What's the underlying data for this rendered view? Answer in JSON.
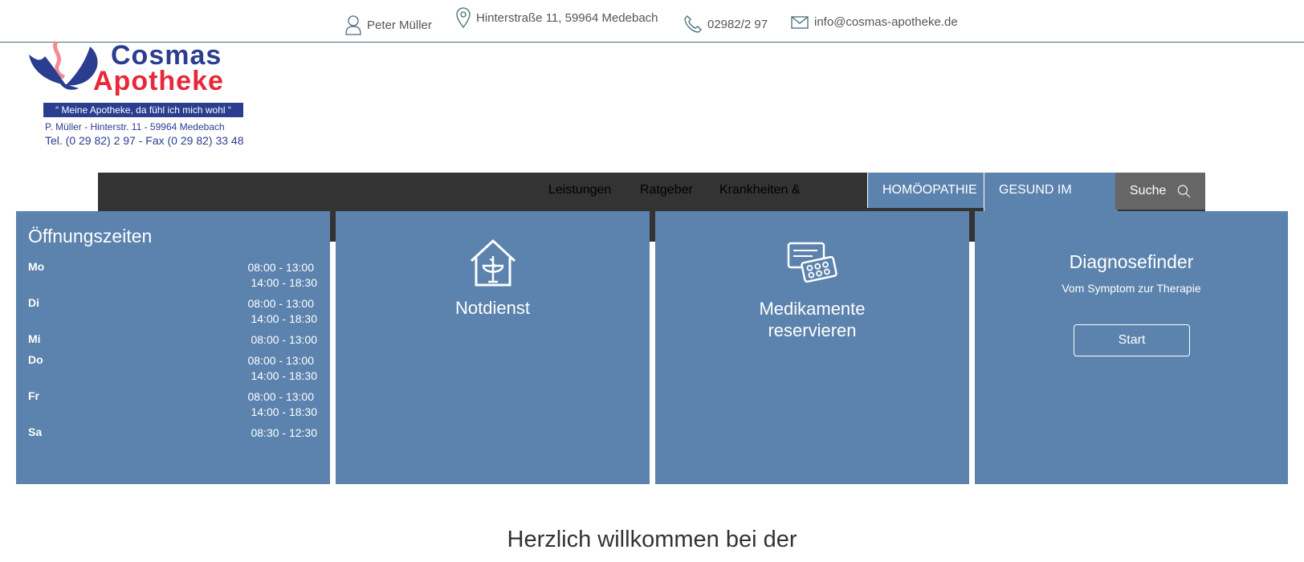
{
  "topbar": {
    "owner": "Peter Müller",
    "address": "Hinterstraße 11, 59964 Medebach",
    "phone": "02982/2 97",
    "email": "info@cosmas-apotheke.de"
  },
  "logo": {
    "name_line1": "Cosmas",
    "name_line2": "Apotheke",
    "slogan": "“ Meine Apotheke, da fühl ich mich wohl “",
    "line1": "P. Müller - Hinterstr. 11 - 59964 Medebach",
    "line2": "Tel. (0 29 82) 2 97 - Fax (0 29 82) 33 48",
    "colors": {
      "blue": "#2b3d8f",
      "red": "#e8283a"
    }
  },
  "nav": {
    "links": [
      "Leistungen",
      "Ratgeber",
      "Krankheiten &"
    ],
    "tab_homoeopathie": "HOMÖOPATHIE",
    "tab_gesund": "GESUND IM",
    "search_label": "Suche",
    "colors": {
      "bar": "#333333",
      "tab": "#5b83ad",
      "search": "#666666"
    }
  },
  "opening_hours": {
    "title": "Öffnungszeiten",
    "days": [
      {
        "day": "Mo",
        "times": [
          "08:00 - 13:00",
          "14:00 - 18:30"
        ]
      },
      {
        "day": "Di",
        "times": [
          "08:00 - 13:00",
          "14:00 - 18:30"
        ]
      },
      {
        "day": "Mi",
        "times": [
          "08:00 - 13:00"
        ]
      },
      {
        "day": "Do",
        "times": [
          "08:00 - 13:00",
          "14:00 - 18:30"
        ]
      },
      {
        "day": "Fr",
        "times": [
          "08:00 - 13:00",
          "14:00 - 18:30"
        ]
      },
      {
        "day": "Sa",
        "times": [
          "08:30 - 12:30"
        ]
      }
    ]
  },
  "cards": {
    "notdienst": {
      "label": "Notdienst",
      "icon": "pharmacy-house-icon"
    },
    "medikamente": {
      "label_line1": "Medikamente",
      "label_line2": "reservieren",
      "icon": "medication-icon"
    },
    "diagnosefinder": {
      "title": "Diagnosefinder",
      "subtitle": "Vom Symptom zur Therapie",
      "button": "Start"
    },
    "color": "#5b83ad"
  },
  "welcome": "Herzlich willkommen bei der"
}
